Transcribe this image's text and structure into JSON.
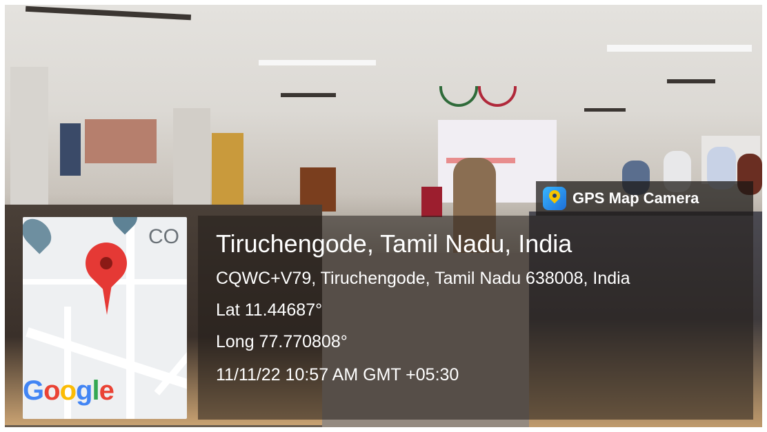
{
  "overlay": {
    "app_name": "GPS Map Camera",
    "location_title": "Tiruchengode, Tamil Nadu, India",
    "address": "CQWC+V79, Tiruchengode, Tamil Nadu 638008, India",
    "latitude": "Lat 11.44687°",
    "longitude": "Long 77.770808°",
    "datetime": "11/11/22 10:57 AM GMT +05:30"
  },
  "map": {
    "partial_label": "CO",
    "logo_letters": [
      "G",
      "o",
      "o",
      "g",
      "l",
      "e"
    ],
    "logo_colors": [
      "#4285F4",
      "#EA4335",
      "#FBBC05",
      "#4285F4",
      "#34A853",
      "#EA4335"
    ]
  },
  "icons": {
    "app_icon": "map-pin-app-icon",
    "location_marker": "location-pin-icon",
    "school_marker": "graduation-cap-icon"
  }
}
